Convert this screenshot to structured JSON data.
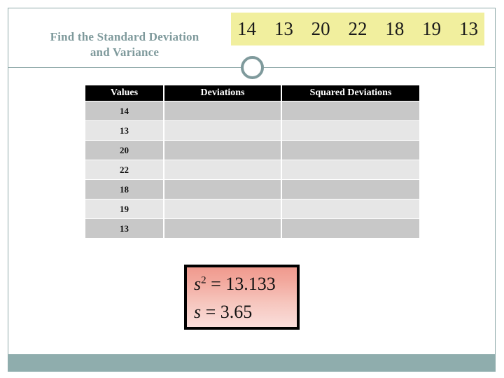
{
  "slide": {
    "title": "Find the Standard Deviation and Variance",
    "title_line1": "Find the Standard Deviation",
    "title_line2": "and Variance"
  },
  "values_strip": {
    "values": [
      "14",
      "13",
      "20",
      "22",
      "18",
      "19",
      "13"
    ],
    "highlight_color": "#f1ef9e"
  },
  "table": {
    "headers": [
      "Values",
      "Deviations",
      "Squared Deviations"
    ],
    "rows": [
      {
        "value": "14",
        "deviation": "",
        "squared_deviation": ""
      },
      {
        "value": "13",
        "deviation": "",
        "squared_deviation": ""
      },
      {
        "value": "20",
        "deviation": "",
        "squared_deviation": ""
      },
      {
        "value": "22",
        "deviation": "",
        "squared_deviation": ""
      },
      {
        "value": "18",
        "deviation": "",
        "squared_deviation": ""
      },
      {
        "value": "19",
        "deviation": "",
        "squared_deviation": ""
      },
      {
        "value": "13",
        "deviation": "",
        "squared_deviation": ""
      }
    ],
    "header_bg": "#000000",
    "row_bg_odd": "#c8c8c8",
    "row_bg_even": "#e6e6e6"
  },
  "answer_box": {
    "variance_symbol": "s",
    "variance_exponent": "2",
    "variance_equals": " = ",
    "variance_value": "13.133",
    "stddev_symbol": "s",
    "stddev_equals": " = ",
    "stddev_value": "3.65",
    "border_color": "#000000",
    "fill_top": "#f09a8e",
    "fill_bottom": "#fadedb"
  },
  "chrome": {
    "accent_color": "#7f9a9c",
    "footer_color": "#8fadad"
  }
}
